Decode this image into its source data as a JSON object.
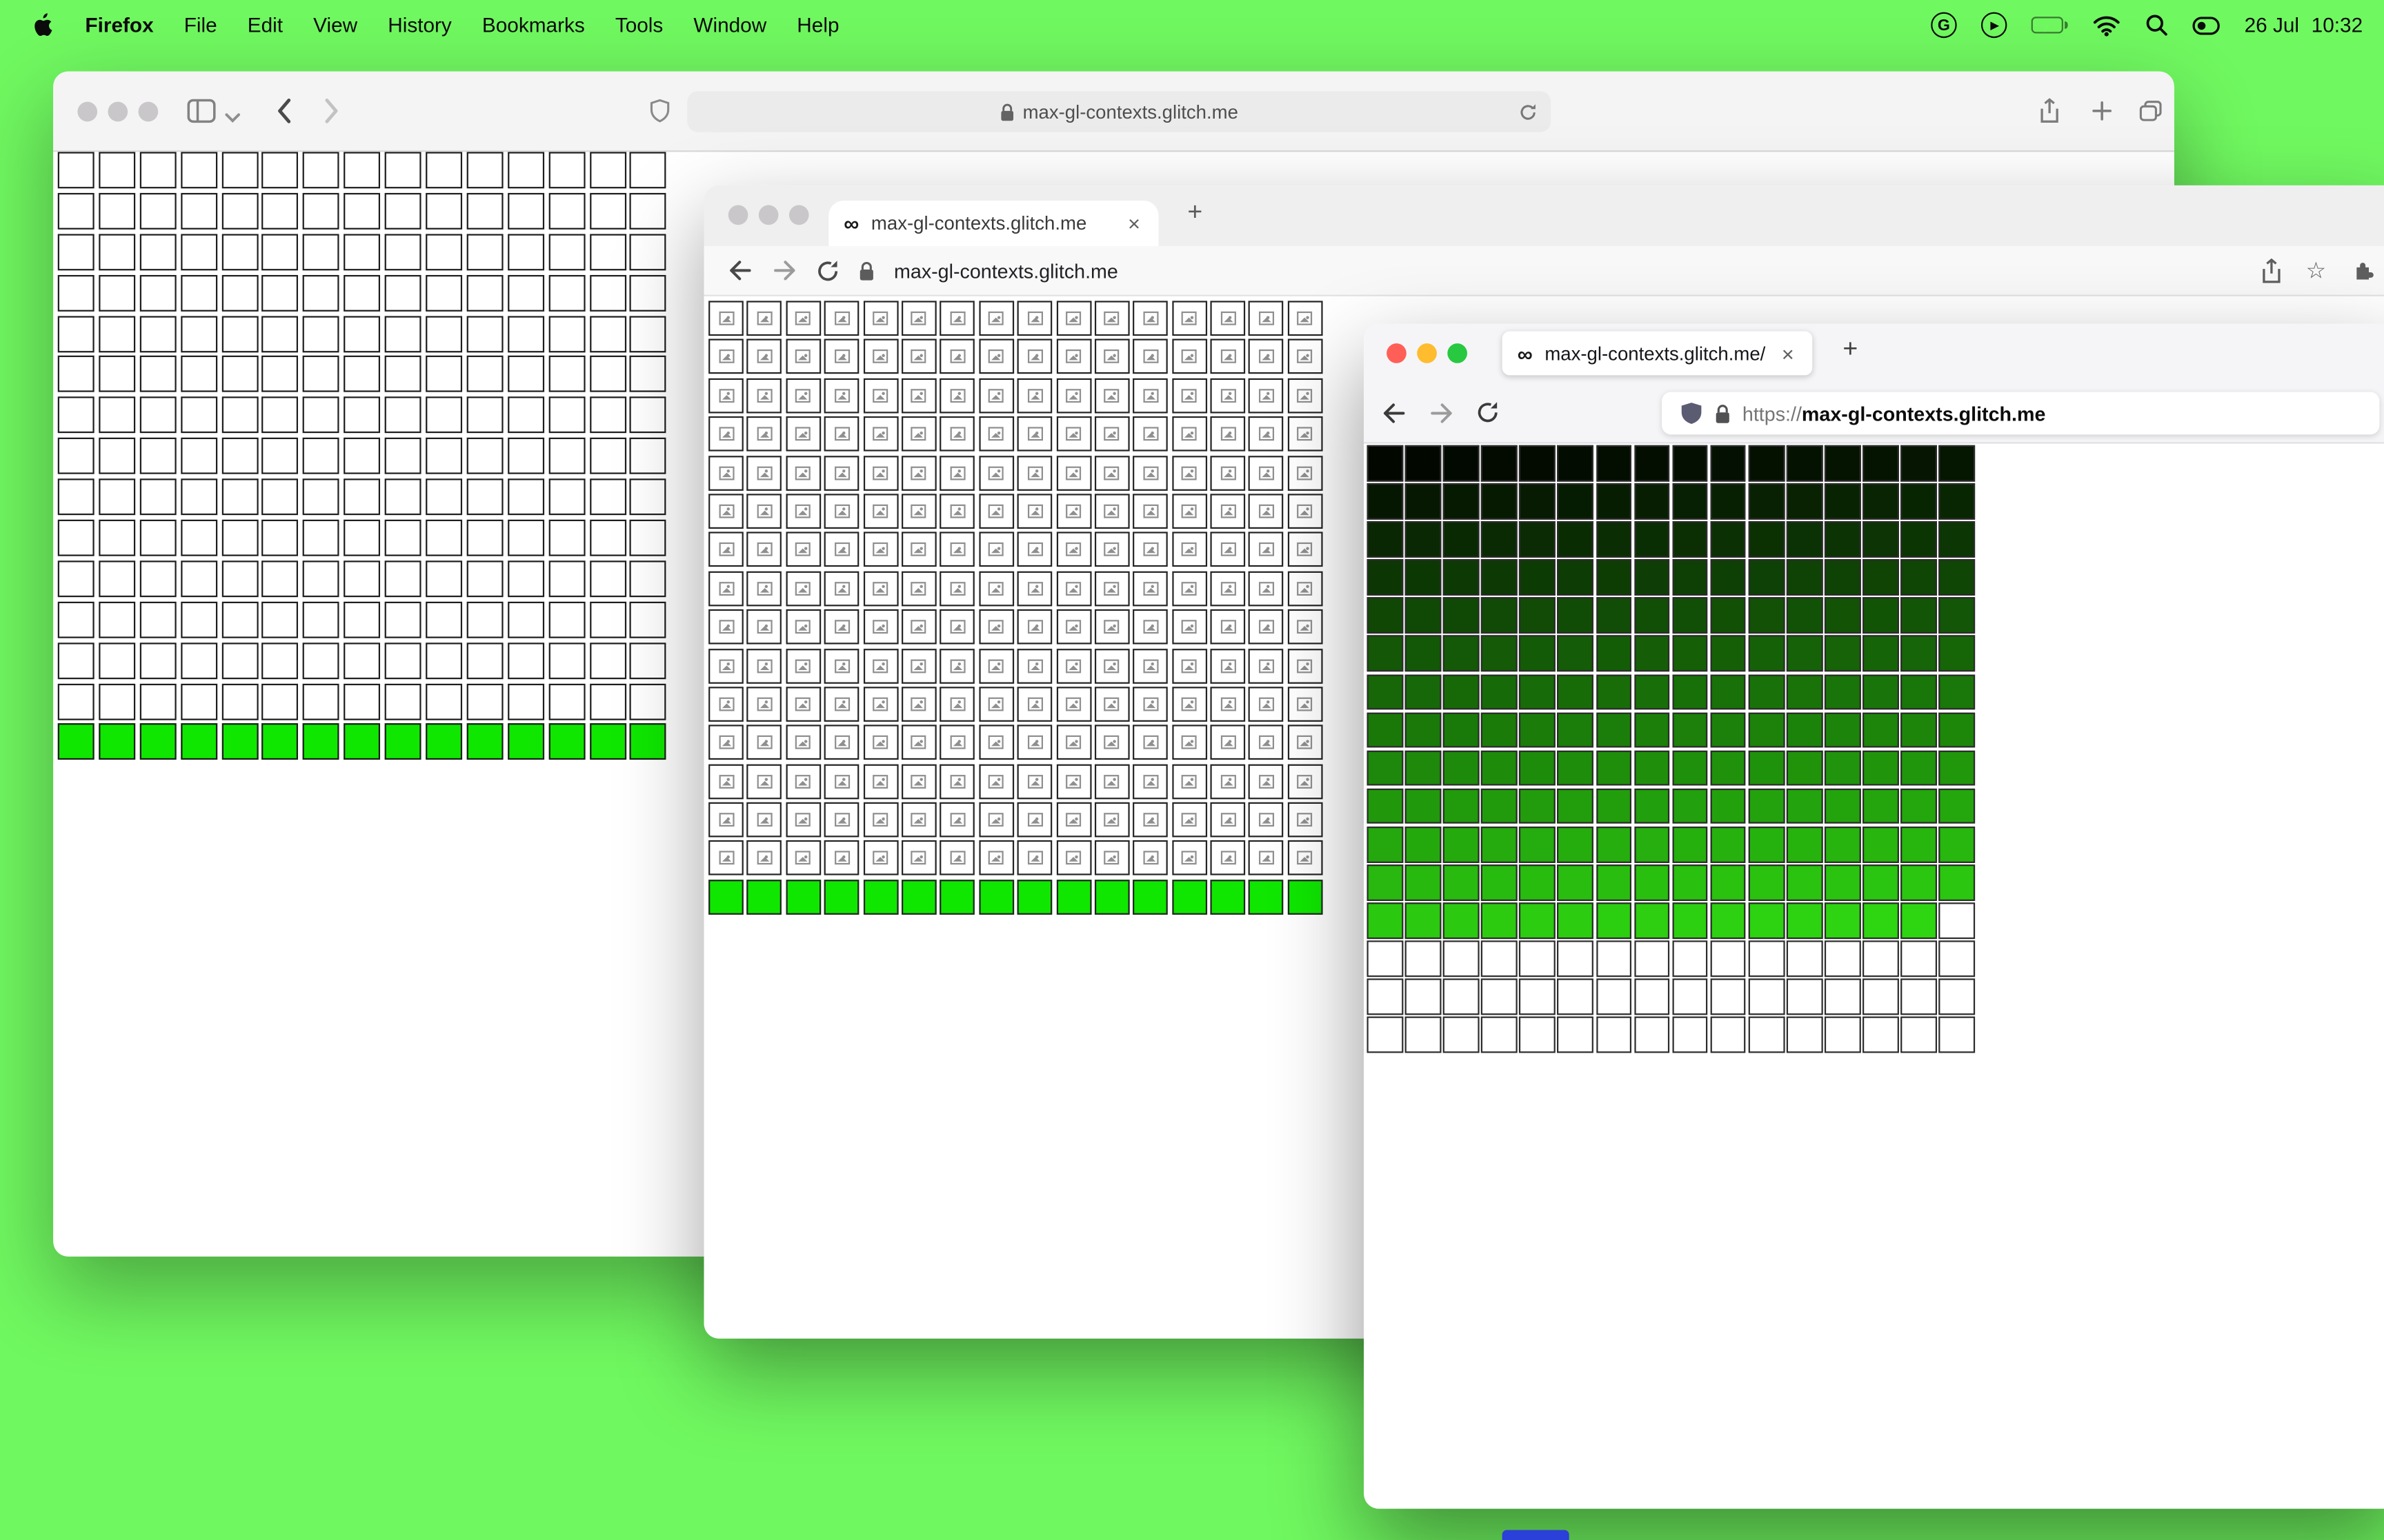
{
  "menubar": {
    "app_name": "Firefox",
    "menus": [
      "File",
      "Edit",
      "View",
      "History",
      "Bookmarks",
      "Tools",
      "Window",
      "Help"
    ],
    "status": {
      "date": "26 Jul",
      "time": "10:32"
    }
  },
  "glyphs": {
    "infinity": "∞",
    "close": "×",
    "plus": "+",
    "play": "▶",
    "grammarly": "G",
    "star": "☆"
  },
  "safari_window": {
    "url": "max-gl-contexts.glitch.me",
    "grid": {
      "cols": 15,
      "rows": 15,
      "green_rows": [
        14
      ],
      "cell_white": "#ffffff",
      "cell_green": "#0fe700",
      "border": "#1d1d1d"
    }
  },
  "chrome_window": {
    "tab_title": "max-gl-contexts.glitch.me",
    "url": "max-gl-contexts.glitch.me",
    "grid": {
      "cols": 16,
      "rows": 16,
      "green_rows": [
        15
      ],
      "broken": true,
      "cell_white": "#ffffff",
      "cell_green": "#0fe700",
      "border": "#242424"
    }
  },
  "firefox_window": {
    "tab_title": "max-gl-contexts.glitch.me/",
    "url_scheme": "https://",
    "url_host": "max-gl-contexts.glitch.me",
    "grid": {
      "cols": 16,
      "rows": 16,
      "filled": 207,
      "from": [
        2,
        7,
        0
      ],
      "to": [
        46,
        214,
        17
      ],
      "empty": "#ffffff",
      "border": "#2c2c2c"
    }
  },
  "colors": {
    "desktop": "#70f860",
    "cell_green": "#0fe700",
    "dock_peek": "#2b3fd9"
  }
}
